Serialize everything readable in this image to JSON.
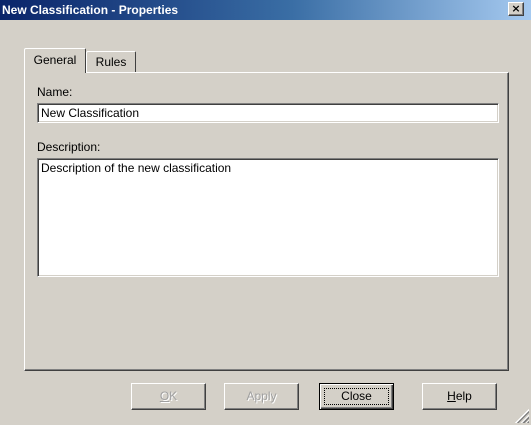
{
  "window": {
    "title": "New Classification - Properties",
    "close_symbol": "×"
  },
  "tabs": [
    {
      "label": "General",
      "selected": true
    },
    {
      "label": "Rules",
      "selected": false
    }
  ],
  "form": {
    "name_label": "Name:",
    "name_value": "New Classification",
    "description_label": "Description:",
    "description_value": "Description of the new classification"
  },
  "buttons": {
    "ok": {
      "label_first": "O",
      "label_rest": "K",
      "enabled": false
    },
    "apply": {
      "label": "Apply",
      "enabled": false
    },
    "close": {
      "label": "Close",
      "enabled": true,
      "default": true
    },
    "help": {
      "label_first": "H",
      "label_rest": "elp",
      "enabled": true
    }
  },
  "colors": {
    "face": "#d4d0c8",
    "title_active": "#0a246a"
  }
}
